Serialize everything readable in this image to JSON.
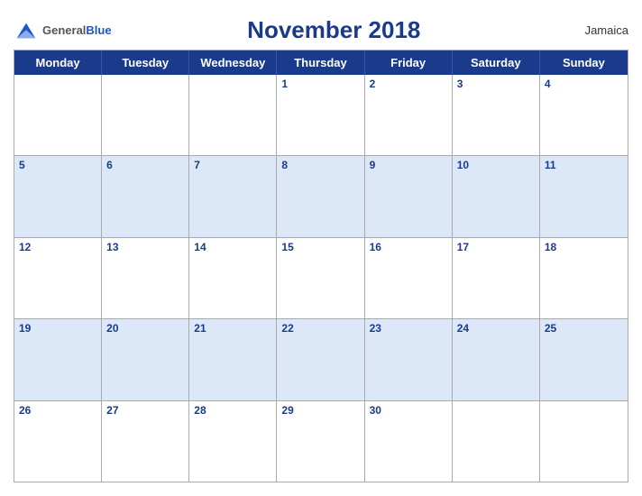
{
  "header": {
    "logo_general": "General",
    "logo_blue": "Blue",
    "title": "November 2018",
    "country": "Jamaica"
  },
  "weekdays": [
    "Monday",
    "Tuesday",
    "Wednesday",
    "Thursday",
    "Friday",
    "Saturday",
    "Sunday"
  ],
  "rows": [
    {
      "shaded": false,
      "cells": [
        {
          "day": "",
          "empty": true
        },
        {
          "day": "",
          "empty": true
        },
        {
          "day": "",
          "empty": true
        },
        {
          "day": "1",
          "empty": false
        },
        {
          "day": "2",
          "empty": false
        },
        {
          "day": "3",
          "empty": false
        },
        {
          "day": "4",
          "empty": false
        }
      ]
    },
    {
      "shaded": true,
      "cells": [
        {
          "day": "5",
          "empty": false
        },
        {
          "day": "6",
          "empty": false
        },
        {
          "day": "7",
          "empty": false
        },
        {
          "day": "8",
          "empty": false
        },
        {
          "day": "9",
          "empty": false
        },
        {
          "day": "10",
          "empty": false
        },
        {
          "day": "11",
          "empty": false
        }
      ]
    },
    {
      "shaded": false,
      "cells": [
        {
          "day": "12",
          "empty": false
        },
        {
          "day": "13",
          "empty": false
        },
        {
          "day": "14",
          "empty": false
        },
        {
          "day": "15",
          "empty": false
        },
        {
          "day": "16",
          "empty": false
        },
        {
          "day": "17",
          "empty": false
        },
        {
          "day": "18",
          "empty": false
        }
      ]
    },
    {
      "shaded": true,
      "cells": [
        {
          "day": "19",
          "empty": false
        },
        {
          "day": "20",
          "empty": false
        },
        {
          "day": "21",
          "empty": false
        },
        {
          "day": "22",
          "empty": false
        },
        {
          "day": "23",
          "empty": false
        },
        {
          "day": "24",
          "empty": false
        },
        {
          "day": "25",
          "empty": false
        }
      ]
    },
    {
      "shaded": false,
      "cells": [
        {
          "day": "26",
          "empty": false
        },
        {
          "day": "27",
          "empty": false
        },
        {
          "day": "28",
          "empty": false
        },
        {
          "day": "29",
          "empty": false
        },
        {
          "day": "30",
          "empty": false
        },
        {
          "day": "",
          "empty": true
        },
        {
          "day": "",
          "empty": true
        }
      ]
    }
  ]
}
